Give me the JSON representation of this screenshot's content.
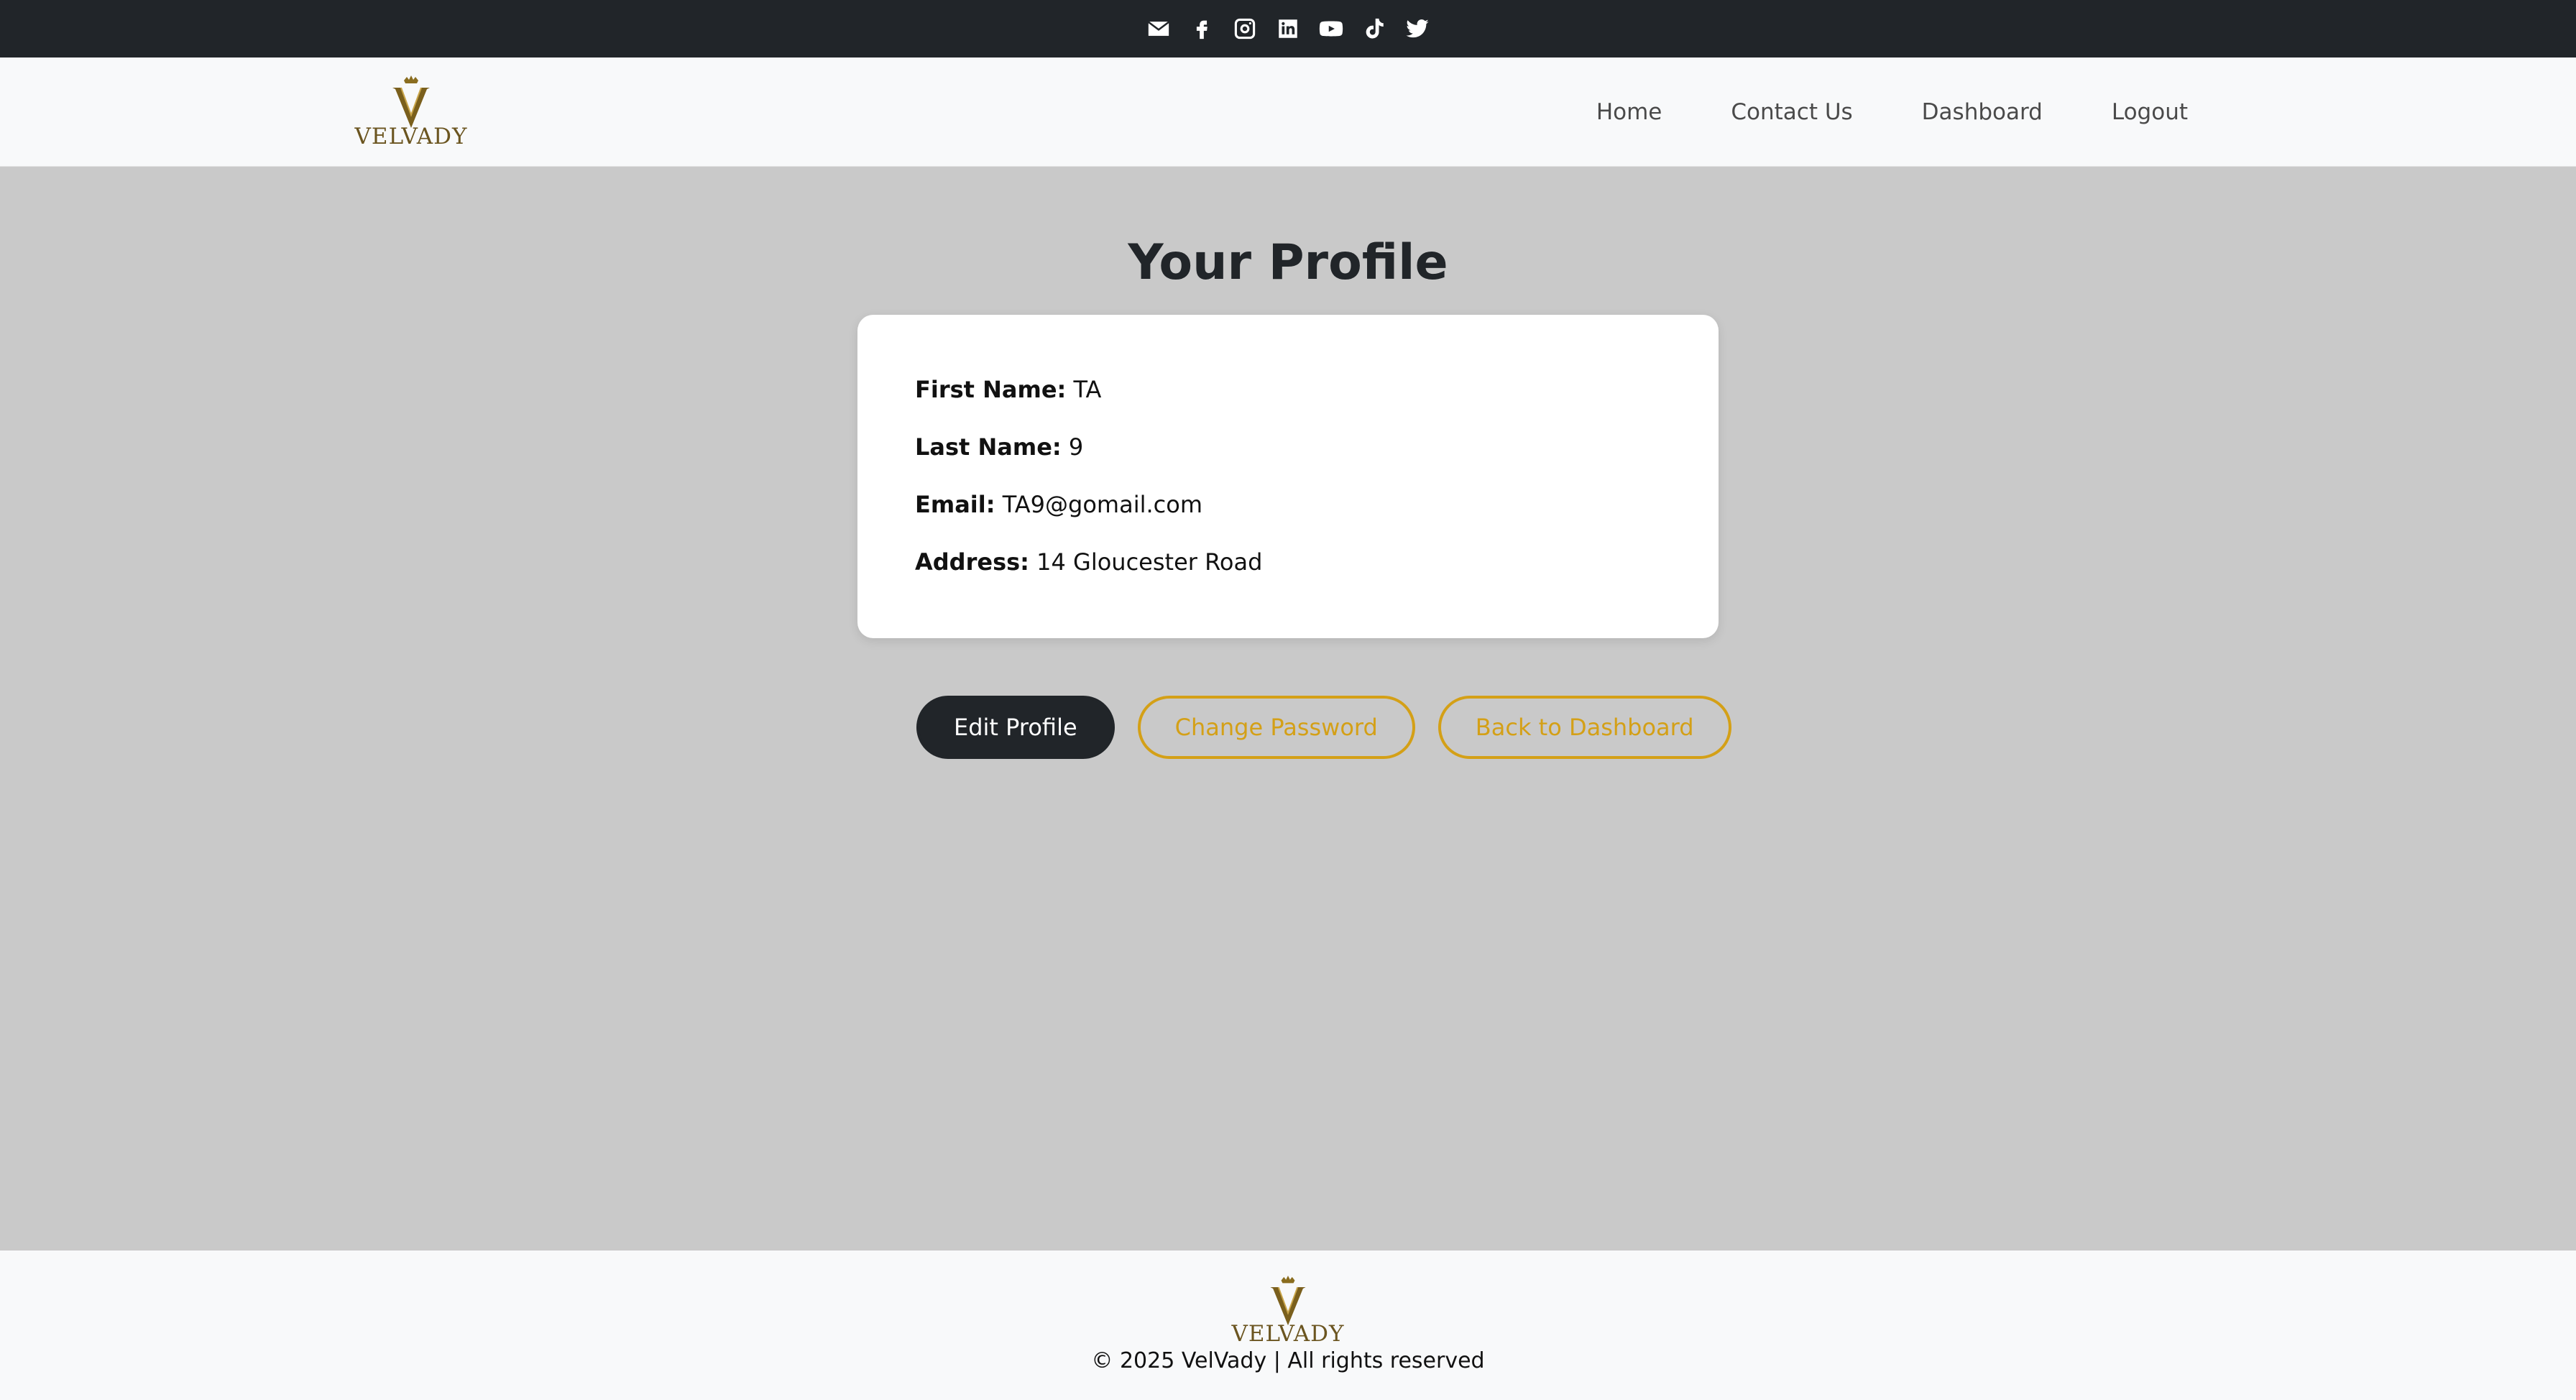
{
  "social": {
    "icons": [
      "envelope-icon",
      "facebook-icon",
      "instagram-icon",
      "linkedin-icon",
      "youtube-icon",
      "tiktok-icon",
      "twitter-icon"
    ]
  },
  "brand": {
    "name": "VELVADY",
    "color": "#6b5520"
  },
  "nav": {
    "items": [
      {
        "label": "Home"
      },
      {
        "label": "Contact Us"
      },
      {
        "label": "Dashboard"
      },
      {
        "label": "Logout"
      }
    ]
  },
  "main": {
    "title": "Your Profile",
    "fields": [
      {
        "label": "First Name:",
        "value": "TA"
      },
      {
        "label": "Last Name:",
        "value": "9"
      },
      {
        "label": "Email:",
        "value": "TA9@gomail.com"
      },
      {
        "label": "Address:",
        "value": "14 Gloucester Road"
      }
    ],
    "buttons": {
      "edit": "Edit Profile",
      "change_password": "Change Password",
      "back": "Back to Dashboard"
    }
  },
  "footer": {
    "brand_name": "VELVADY",
    "copyright": "© 2025 VelVady | All rights reserved"
  },
  "colors": {
    "topbar": "#212529",
    "accent": "#d4a017",
    "background": "#c9c9c9"
  }
}
